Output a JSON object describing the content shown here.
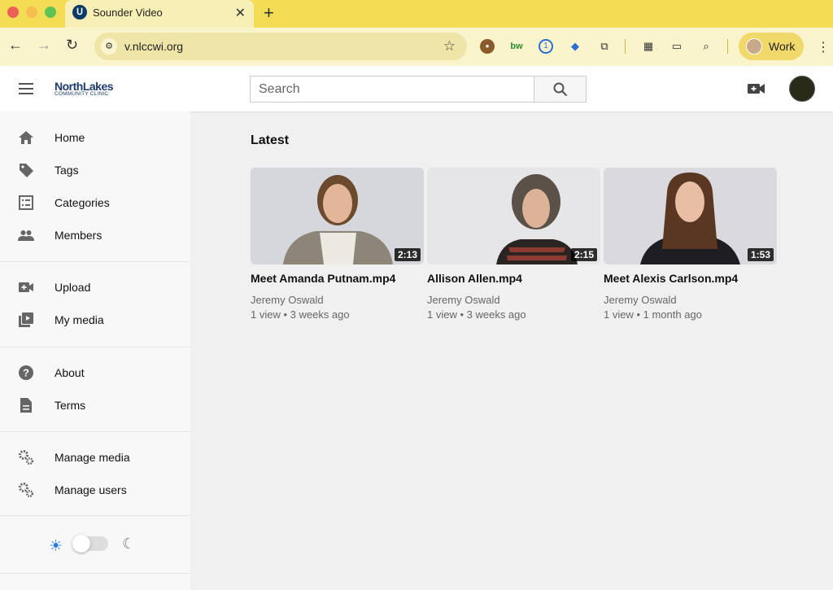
{
  "browser": {
    "tab_title": "Sounder Video",
    "tab_favicon": "sounder-logo-icon",
    "url": "v.nlccwi.org",
    "profile_label": "Work",
    "extensions": [
      "cookie-icon",
      "bw-icon",
      "password-manager-icon",
      "tag-extension-icon",
      "puzzle-icon",
      "qr-code-icon",
      "cast-icon",
      "search-page-icon"
    ]
  },
  "header": {
    "logo_main": "NorthLakes",
    "logo_sub": "COMMUNITY CLINIC",
    "search_placeholder": "Search"
  },
  "sidebar": {
    "items": [
      {
        "label": "Home",
        "icon": "home-icon"
      },
      {
        "label": "Tags",
        "icon": "tag-icon"
      },
      {
        "label": "Categories",
        "icon": "list-icon"
      },
      {
        "label": "Members",
        "icon": "people-icon"
      },
      {
        "label": "Upload",
        "icon": "video-add-icon"
      },
      {
        "label": "My media",
        "icon": "media-library-icon"
      },
      {
        "label": "About",
        "icon": "help-icon"
      },
      {
        "label": "Terms",
        "icon": "document-icon"
      },
      {
        "label": "Manage media",
        "icon": "gears-icon"
      },
      {
        "label": "Manage users",
        "icon": "gears-icon"
      }
    ],
    "theme": {
      "dark_mode": false
    }
  },
  "main": {
    "section_title": "Latest",
    "videos": [
      {
        "title": "Meet Amanda Putnam.mp4",
        "duration": "2:13",
        "author": "Jeremy Oswald",
        "meta": "1 view • 3 weeks ago"
      },
      {
        "title": "Allison Allen.mp4",
        "duration": "2:15",
        "author": "Jeremy Oswald",
        "meta": "1 view • 3 weeks ago"
      },
      {
        "title": "Meet Alexis Carlson.mp4",
        "duration": "1:53",
        "author": "Jeremy Oswald",
        "meta": "1 view • 1 month ago"
      }
    ]
  },
  "colors": {
    "tab_bar": "#f2dd55",
    "toolbar": "#faf4cc",
    "logo": "#1d3c6b",
    "theme_sun": "#2c7be5"
  }
}
